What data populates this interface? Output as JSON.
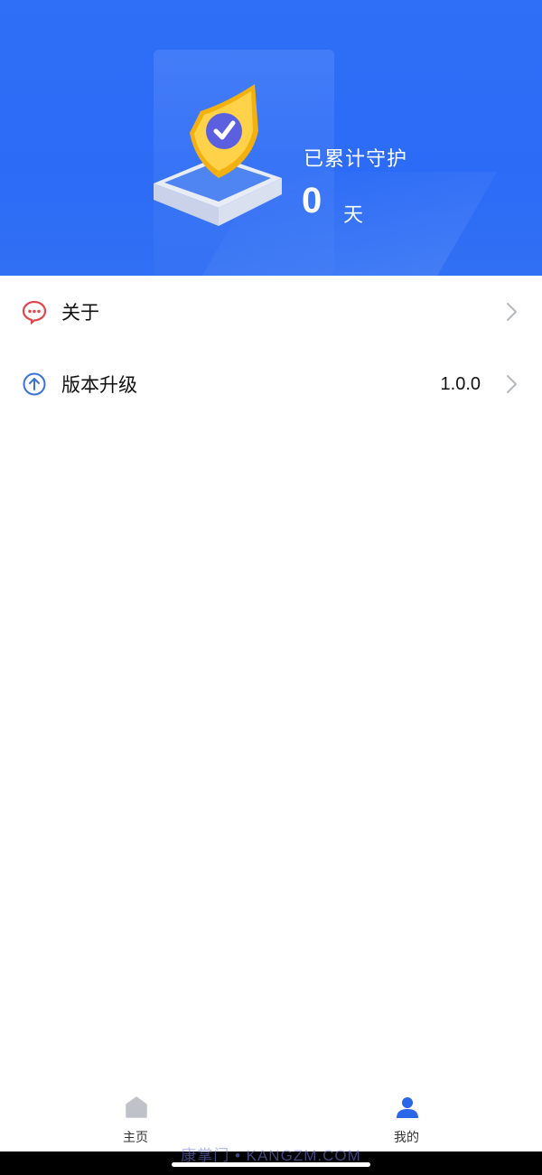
{
  "header": {
    "guard_label": "已累计守护",
    "guard_days": "0",
    "guard_unit": "天",
    "illustration_icon": "shield-check-icon"
  },
  "menu": {
    "items": [
      {
        "label": "关于",
        "icon": "chat-bubble-icon",
        "value": ""
      },
      {
        "label": "版本升级",
        "icon": "upgrade-arrow-icon",
        "value": "1.0.0"
      }
    ]
  },
  "tabbar": {
    "tabs": [
      {
        "label": "主页",
        "icon": "home-icon",
        "active": false
      },
      {
        "label": "我的",
        "icon": "user-icon",
        "active": true
      }
    ]
  },
  "watermark": "康掌门 • KANGZM.COM",
  "colors": {
    "primary": "#2f6ff7",
    "tab_active": "#2a66e8",
    "tab_inactive": "#bfc3c9",
    "about_icon": "#e0474c",
    "upgrade_icon": "#3a72d8"
  }
}
